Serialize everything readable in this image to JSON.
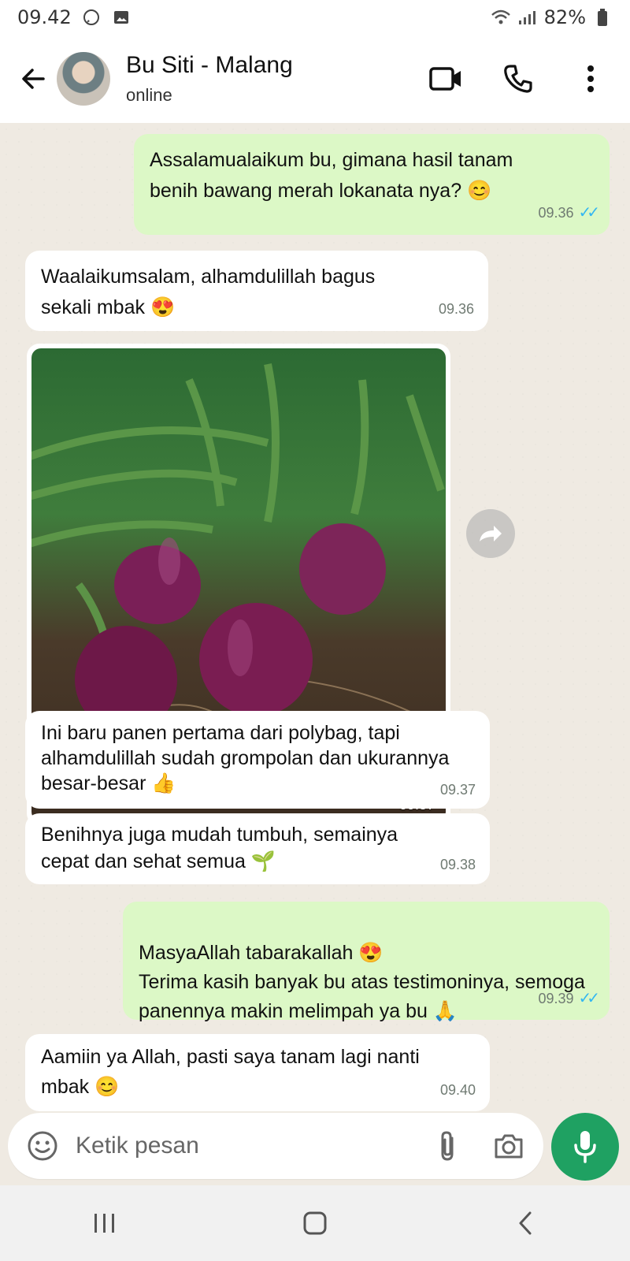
{
  "status_bar": {
    "time": "09.42",
    "battery": "82%"
  },
  "header": {
    "name": "Bu Siti - Malang",
    "status": "online"
  },
  "messages": [
    {
      "text": "Assalamualaikum bu, gimana hasil tanam benih bawang merah lokanata nya? 😊",
      "time": "09.36"
    },
    {
      "text": "Waalaikumsalam, alhamdulillah bagus sekali mbak 😍",
      "time": "09.36"
    },
    {
      "image_time": "09.37"
    },
    {
      "text": "Ini baru panen pertama dari polybag, tapi alhamdulillah sudah grompolan dan ukurannya besar-besar 👍",
      "time": "09.37"
    },
    {
      "text": "Benihnya juga mudah tumbuh, semainya cepat dan sehat semua 🌱",
      "time": "09.38"
    },
    {
      "text": "MasyaAllah tabarakallah 😍\nTerima kasih banyak bu atas testimoninya, semoga panennya makin melimpah ya bu 🙏",
      "time": "09.39"
    },
    {
      "text": "Aamiin ya Allah, pasti saya tanam lagi nanti mbak 😊",
      "time": "09.40"
    }
  ],
  "composer": {
    "placeholder": "Ketik pesan"
  },
  "colors": {
    "outgoing": "#dcf8c6",
    "incoming": "#ffffff",
    "accent": "#1fa162",
    "read_ticks": "#34b7f1"
  },
  "icons": [
    "whatsapp-icon",
    "gallery-icon",
    "wifi-icon",
    "signal-icon",
    "battery-icon",
    "back-arrow-icon",
    "video-call-icon",
    "voice-call-icon",
    "more-icon",
    "forward-icon",
    "emoji-icon",
    "attach-icon",
    "camera-icon",
    "mic-icon",
    "recent-apps-icon",
    "home-icon",
    "back-icon"
  ]
}
